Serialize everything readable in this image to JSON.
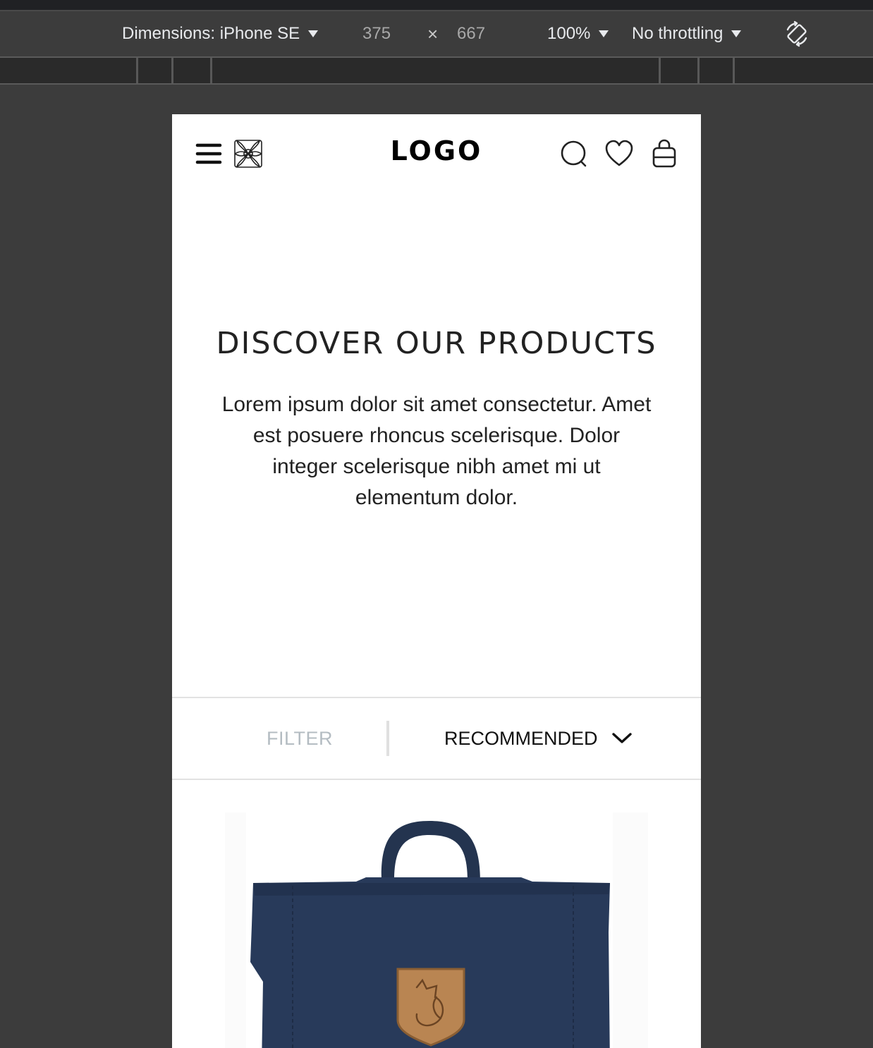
{
  "devtools": {
    "device_label": "Dimensions: iPhone SE",
    "width": "375",
    "times": "×",
    "height": "667",
    "zoom": "100%",
    "throttling": "No throttling",
    "rotate_icon": "rotate-icon"
  },
  "header": {
    "logo": "LOGO",
    "icons": [
      "hamburger-menu-icon",
      "ornament-icon",
      "search-icon",
      "heart-icon",
      "bag-icon"
    ]
  },
  "hero": {
    "title": "DISCOVER OUR PRODUCTS",
    "description": "Lorem ipsum dolor sit amet consectetur. Amet est posuere rhoncus scelerisque. Dolor integer scelerisque nibh amet mi ut elementum dolor."
  },
  "filter_bar": {
    "filter_label": "FILTER",
    "sort_label": "RECOMMENDED"
  },
  "colors": {
    "page_bg": "#3c3c3c",
    "viewport_bg": "#ffffff",
    "filter_muted": "#b4bcc2",
    "bag_navy": "#283a5a",
    "patch_leather": "#b98552"
  }
}
